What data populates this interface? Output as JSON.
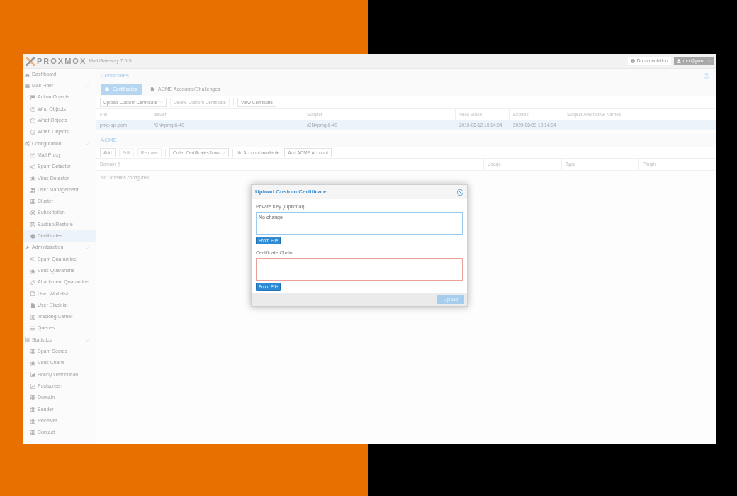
{
  "header": {
    "logo": "PROXMOX",
    "product": "Mail Gateway 7.0-5",
    "documentation_button": "Documentation",
    "user_menu": "root@pam"
  },
  "sidebar": {
    "items": [
      {
        "label": "Dashboard",
        "selected": false
      },
      {
        "label": "Mail Filter",
        "selected": false,
        "expanded": true,
        "children": [
          {
            "label": "Action Objects",
            "selected": false
          },
          {
            "label": "Who Objects",
            "selected": false
          },
          {
            "label": "What Objects",
            "selected": false
          },
          {
            "label": "When Objects",
            "selected": false
          }
        ]
      },
      {
        "label": "Configuration",
        "selected": false,
        "expanded": true,
        "children": [
          {
            "label": "Mail Proxy",
            "selected": false
          },
          {
            "label": "Spam Detector",
            "selected": false
          },
          {
            "label": "Virus Detector",
            "selected": false
          },
          {
            "label": "User Management",
            "selected": false
          },
          {
            "label": "Cluster",
            "selected": false
          },
          {
            "label": "Subscription",
            "selected": false
          },
          {
            "label": "Backup/Restore",
            "selected": false
          },
          {
            "label": "Certificates",
            "selected": true
          }
        ]
      },
      {
        "label": "Administration",
        "selected": false,
        "expanded": true,
        "children": [
          {
            "label": "Spam Quarantine",
            "selected": false
          },
          {
            "label": "Virus Quarantine",
            "selected": false
          },
          {
            "label": "Attachment Quarantine",
            "selected": false
          },
          {
            "label": "User Whitelist",
            "selected": false
          },
          {
            "label": "User Blacklist",
            "selected": false
          },
          {
            "label": "Tracking Center",
            "selected": false
          },
          {
            "label": "Queues",
            "selected": false
          }
        ]
      },
      {
        "label": "Statistics",
        "selected": false,
        "expanded": true,
        "children": [
          {
            "label": "Spam Scores",
            "selected": false
          },
          {
            "label": "Virus Charts",
            "selected": false
          },
          {
            "label": "Hourly Distribution",
            "selected": false
          },
          {
            "label": "Postscreen",
            "selected": false
          },
          {
            "label": "Domain",
            "selected": false
          },
          {
            "label": "Sender",
            "selected": false
          },
          {
            "label": "Receiver",
            "selected": false
          },
          {
            "label": "Contact",
            "selected": false
          }
        ]
      }
    ]
  },
  "certificates_panel": {
    "title": "Certificates",
    "tabs": [
      {
        "label": "Certificates",
        "selected": true
      },
      {
        "label": "ACME Accounts/Challenges",
        "selected": false
      }
    ],
    "toolbar": [
      {
        "kind": "menu",
        "label": "Upload Custom Certificate",
        "disabled": false
      },
      {
        "kind": "button",
        "label": "Delete Custom Certificate",
        "disabled": true
      },
      {
        "kind": "separator"
      },
      {
        "kind": "button",
        "label": "View Certificate",
        "disabled": false
      }
    ],
    "table": {
      "columns": [
        {
          "label": "File",
          "sorted": false
        },
        {
          "label": "Issuer",
          "sorted": false
        },
        {
          "label": "Subject",
          "sorted": false
        },
        {
          "label": "Valid Since",
          "sorted": false
        },
        {
          "label": "Expires",
          "sorted": false
        },
        {
          "label": "Subject Alternative Names",
          "sorted": false
        }
      ],
      "rows": [
        {
          "selected": true,
          "cells": [
            "pmg-api.pem",
            "/CN=pmg-6-40",
            "/CN=pmg-6-40",
            "2019-08-12 10:14:04",
            "2029-08-09 10:14:04"
          ]
        }
      ]
    }
  },
  "acme_panel": {
    "title": "ACME",
    "toolbar": [
      {
        "kind": "button",
        "label": "Add",
        "disabled": false
      },
      {
        "kind": "button",
        "label": "Edit",
        "disabled": true
      },
      {
        "kind": "button",
        "label": "Remove",
        "disabled": true
      },
      {
        "kind": "separator"
      },
      {
        "kind": "menu",
        "label": "Order Certificates Now",
        "disabled": false
      },
      {
        "kind": "separator"
      },
      {
        "kind": "text",
        "label": "No Account available."
      },
      {
        "kind": "button",
        "label": "Add ACME Account",
        "disabled": false
      }
    ],
    "table": {
      "columns": [
        {
          "label": "Domain",
          "sorted": true
        },
        {
          "label": "Usage",
          "sorted": false
        },
        {
          "label": "Type",
          "sorted": false
        },
        {
          "label": "Plugin",
          "sorted": false
        }
      ],
      "empty_text": "No Domains configured"
    }
  },
  "dialog": {
    "title": "Upload Custom Certificate",
    "fields": [
      {
        "label": "Private Key (Optional):",
        "placeholder": "No change",
        "focused": true,
        "invalid": false,
        "button": "From File"
      },
      {
        "label": "Certificate Chain:",
        "focused": false,
        "invalid": true,
        "button": "From File"
      }
    ],
    "upload_button": {
      "label": "Upload",
      "disabled": true
    }
  }
}
